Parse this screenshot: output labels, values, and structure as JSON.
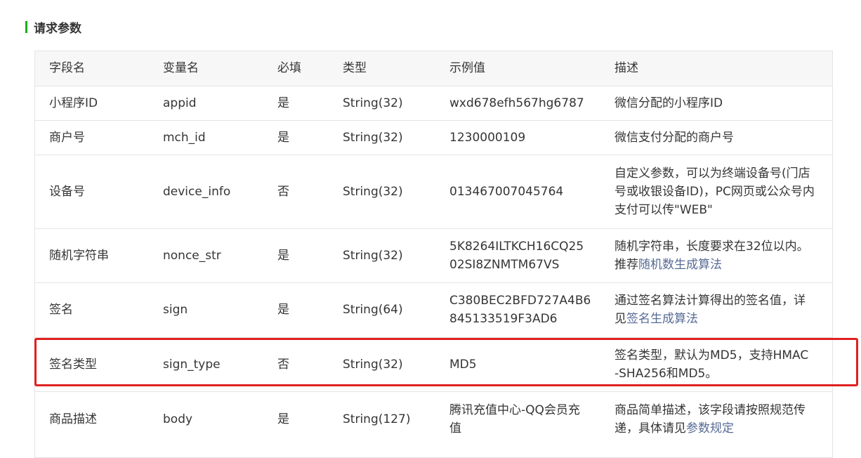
{
  "section": {
    "title": "请求参数",
    "accent": "#1aad19"
  },
  "table": {
    "headers": [
      "字段名",
      "变量名",
      "必填",
      "类型",
      "示例值",
      "描述"
    ],
    "rows": [
      {
        "field": "小程序ID",
        "var": "appid",
        "required": "是",
        "type": "String(32)",
        "example": "wxd678efh567hg6787",
        "desc": "微信分配的小程序ID",
        "link": ""
      },
      {
        "field": "商户号",
        "var": "mch_id",
        "required": "是",
        "type": "String(32)",
        "example": "1230000109",
        "desc": "微信支付分配的商户号",
        "link": ""
      },
      {
        "field": "设备号",
        "var": "device_info",
        "required": "否",
        "type": "String(32)",
        "example": "013467007045764",
        "desc": "自定义参数，可以为终端设备号(门店\n号或收银设备ID)，PC网页或公众号内\n支付可以传\"WEB\"",
        "link": ""
      },
      {
        "field": "随机字符串",
        "var": "nonce_str",
        "required": "是",
        "type": "String(32)",
        "example": "5K8264ILTKCH16CQ25\n02SI8ZNMTM67VS",
        "desc": "随机字符串，长度要求在32位以内。\n推荐",
        "link": "随机数生成算法"
      },
      {
        "field": "签名",
        "var": "sign",
        "required": "是",
        "type": "String(64)",
        "example": "C380BEC2BFD727A4B6\n845133519F3AD6",
        "desc": "通过签名算法计算得出的签名值，详\n见",
        "link": "签名生成算法"
      },
      {
        "field": "签名类型",
        "var": "sign_type",
        "required": "否",
        "type": "String(32)",
        "example": "MD5",
        "desc": "签名类型，默认为MD5，支持HMAC\n-SHA256和MD5。",
        "link": ""
      },
      {
        "field": "商品描述",
        "var": "body",
        "required": "是",
        "type": "String(127)",
        "example": "腾讯充值中心-QQ会员充\n值",
        "desc": "商品简单描述，该字段请按照规范传\n递，具体请见",
        "link": "参数规定"
      }
    ]
  },
  "highlight": {
    "row_index": 5,
    "color": "#e02020"
  },
  "colors": {
    "link": "#576b95",
    "header_bg": "#f7f7f7",
    "border": "#e5e5e5"
  }
}
